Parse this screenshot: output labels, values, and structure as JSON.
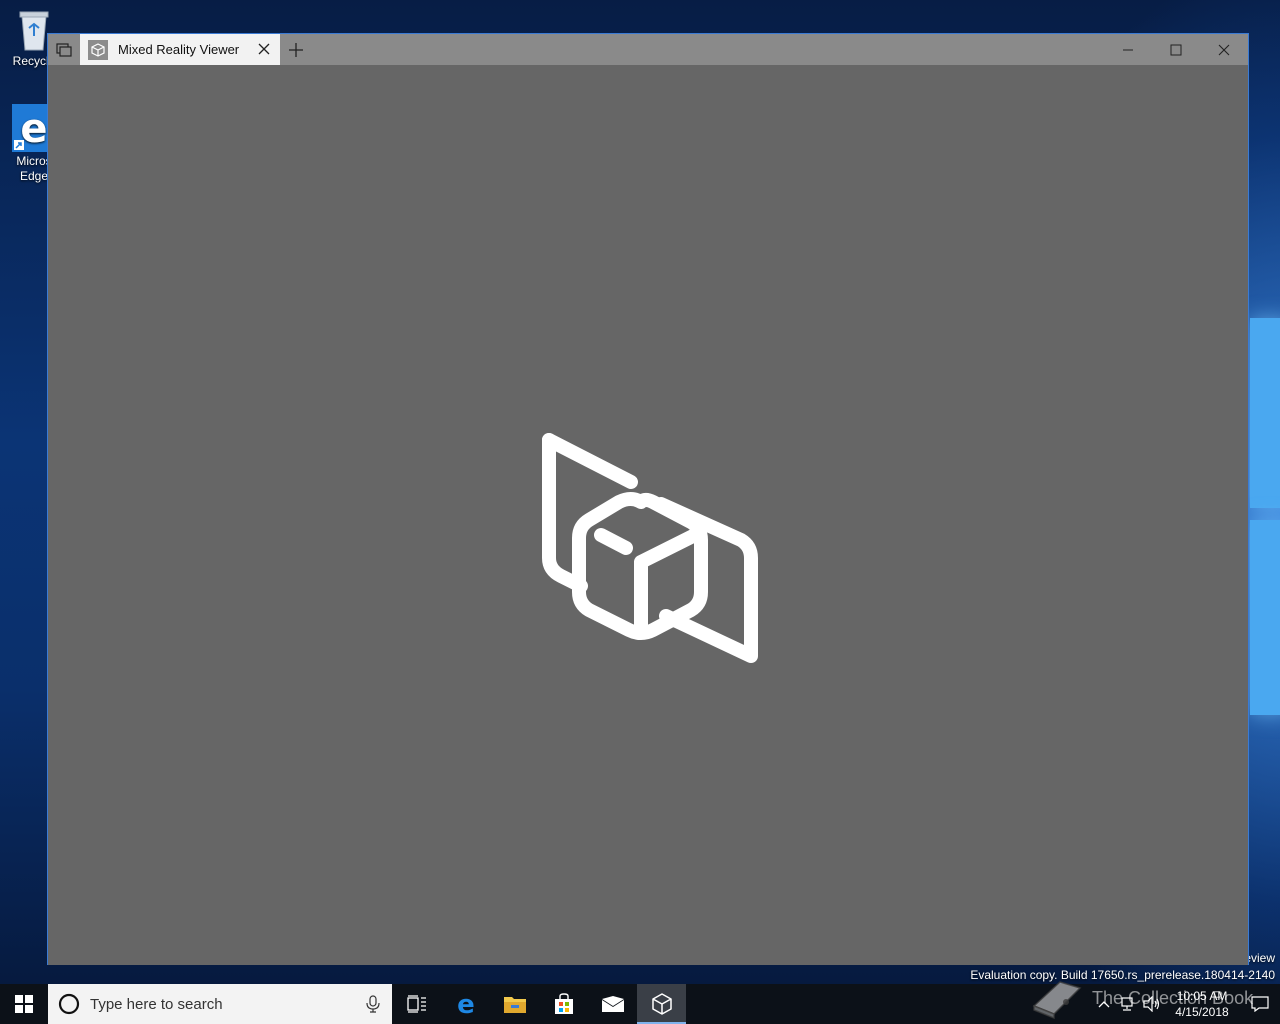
{
  "desktop": {
    "icons": [
      {
        "name": "recycle-bin",
        "label": "Recycle"
      },
      {
        "name": "microsoft-edge",
        "label": "Micros\nEdge"
      }
    ],
    "watermark_top": "eview",
    "watermark_bottom": "Evaluation copy. Build 17650.rs_prerelease.180414-2140"
  },
  "window": {
    "tab_title": "Mixed Reality Viewer",
    "buttons": {
      "set_aside": "tab-list-icon",
      "close_tab": "close-icon",
      "new_tab": "plus-icon",
      "minimize": "minimize-icon",
      "maximize": "maximize-icon",
      "close": "close-icon"
    },
    "splash_icon": "mixed-reality-cube-icon",
    "colors": {
      "content_bg": "#666666",
      "titlebar_bg": "#8a8a8a",
      "tab_bg": "#f2f2f2"
    }
  },
  "taskbar": {
    "search_placeholder": "Type here to search",
    "apps": [
      "task-view-icon",
      "edge-icon",
      "file-explorer-icon",
      "store-icon",
      "mail-icon",
      "mixed-reality-viewer-icon"
    ],
    "active_app": "mixed-reality-viewer-icon",
    "clock": {
      "time": "10:05 AM",
      "date": "4/15/2018"
    },
    "overlay_watermark": "The Collection Book"
  }
}
